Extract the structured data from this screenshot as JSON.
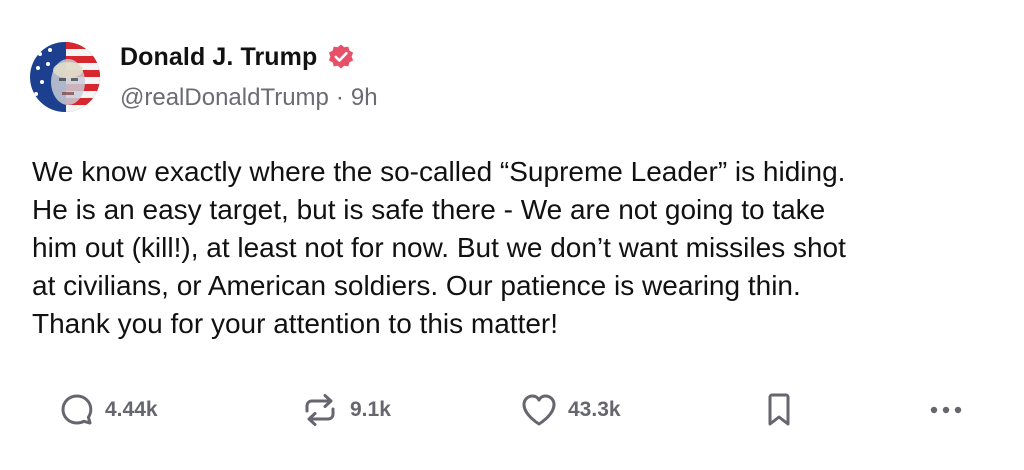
{
  "author": {
    "display_name": "Donald J. Trump",
    "handle": "@realDonaldTrump",
    "separator": "·",
    "time_ago": "9h",
    "verified_color": "#e8506a",
    "avatar_icon": "flag-portrait-avatar"
  },
  "post": {
    "lines": [
      "We know exactly where the so-called “Supreme Leader” is hiding.",
      "He is an easy target, but is safe there - We are not going to take",
      "him out (kill!), at least not for now. But we don’t want missiles shot",
      "at civilians, or American soldiers. Our patience is wearing thin.",
      "Thank you for your attention to this matter!"
    ]
  },
  "actions": {
    "replies": {
      "count": "4.44k",
      "icon": "reply-icon"
    },
    "retruths": {
      "count": "9.1k",
      "icon": "retruth-icon"
    },
    "likes": {
      "count": "43.3k",
      "icon": "heart-icon"
    },
    "bookmark": {
      "icon": "bookmark-icon"
    },
    "more": {
      "icon": "more-options-icon"
    }
  },
  "colors": {
    "text": "#111111",
    "muted": "#6b6b73",
    "icon": "#66666e",
    "background": "#ffffff"
  }
}
